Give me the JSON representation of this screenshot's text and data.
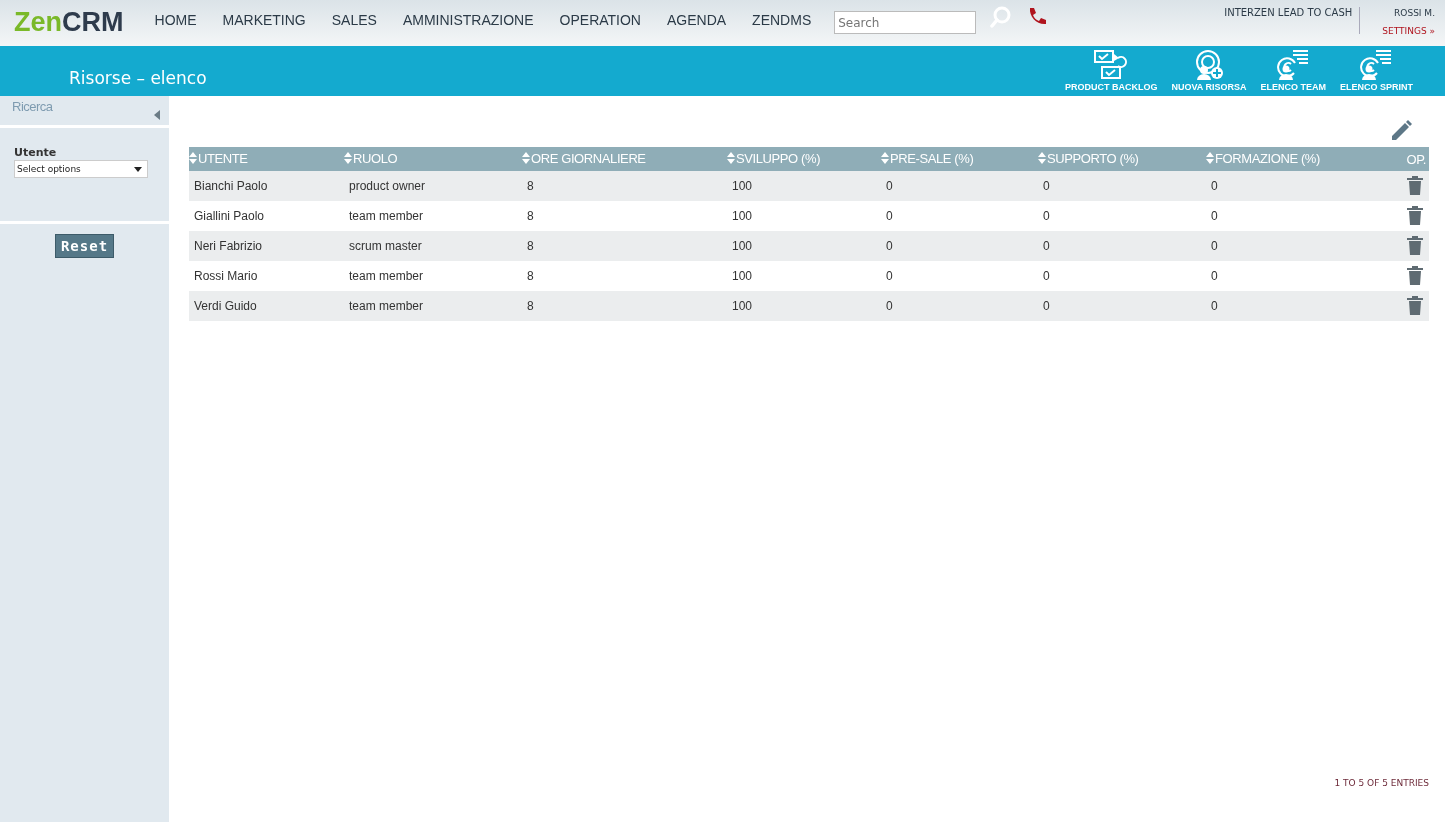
{
  "logo": [
    "Zen",
    "CRM"
  ],
  "nav": [
    "HOME",
    "MARKETING",
    "SALES",
    "AMMINISTRAZIONE",
    "OPERATION",
    "AGENDA",
    "ZENDMS"
  ],
  "search": {
    "placeholder": "Search"
  },
  "company": "INTERZEN LEAD TO CASH",
  "user": {
    "name": "ROSSI M.",
    "settings": "SETTINGS »"
  },
  "page_title": "Risorse – elenco",
  "actions": [
    {
      "label": "PRODUCT BACKLOG",
      "kind": "backlog"
    },
    {
      "label": "NUOVA RISORSA",
      "kind": "add"
    },
    {
      "label": "ELENCO TEAM",
      "kind": "list"
    },
    {
      "label": "ELENCO SPRINT",
      "kind": "list"
    }
  ],
  "sidebar": {
    "title": "Ricerca",
    "filter_label": "Utente",
    "filter_placeholder": "Select options",
    "reset": "Reset"
  },
  "table": {
    "columns": [
      {
        "label": "UTENTE",
        "sortable": true
      },
      {
        "label": "RUOLO",
        "sortable": true
      },
      {
        "label": "ORE GIORNALIERE",
        "sortable": true
      },
      {
        "label": "SVILUPPO (%)",
        "sortable": true
      },
      {
        "label": "PRE-SALE (%)",
        "sortable": true
      },
      {
        "label": "SUPPORTO (%)",
        "sortable": true
      },
      {
        "label": "FORMAZIONE (%)",
        "sortable": true
      },
      {
        "label": "OP.",
        "sortable": false
      }
    ],
    "rows": [
      [
        "Bianchi Paolo",
        "product owner",
        "8",
        "100",
        "0",
        "0",
        "0"
      ],
      [
        "Giallini Paolo",
        "team member",
        "8",
        "100",
        "0",
        "0",
        "0"
      ],
      [
        "Neri Fabrizio",
        "scrum master",
        "8",
        "100",
        "0",
        "0",
        "0"
      ],
      [
        "Rossi Mario",
        "team member",
        "8",
        "100",
        "0",
        "0",
        "0"
      ],
      [
        "Verdi Guido",
        "team member",
        "8",
        "100",
        "0",
        "0",
        "0"
      ]
    ]
  },
  "entries_info": "1 TO 5 OF 5 ENTRIES"
}
